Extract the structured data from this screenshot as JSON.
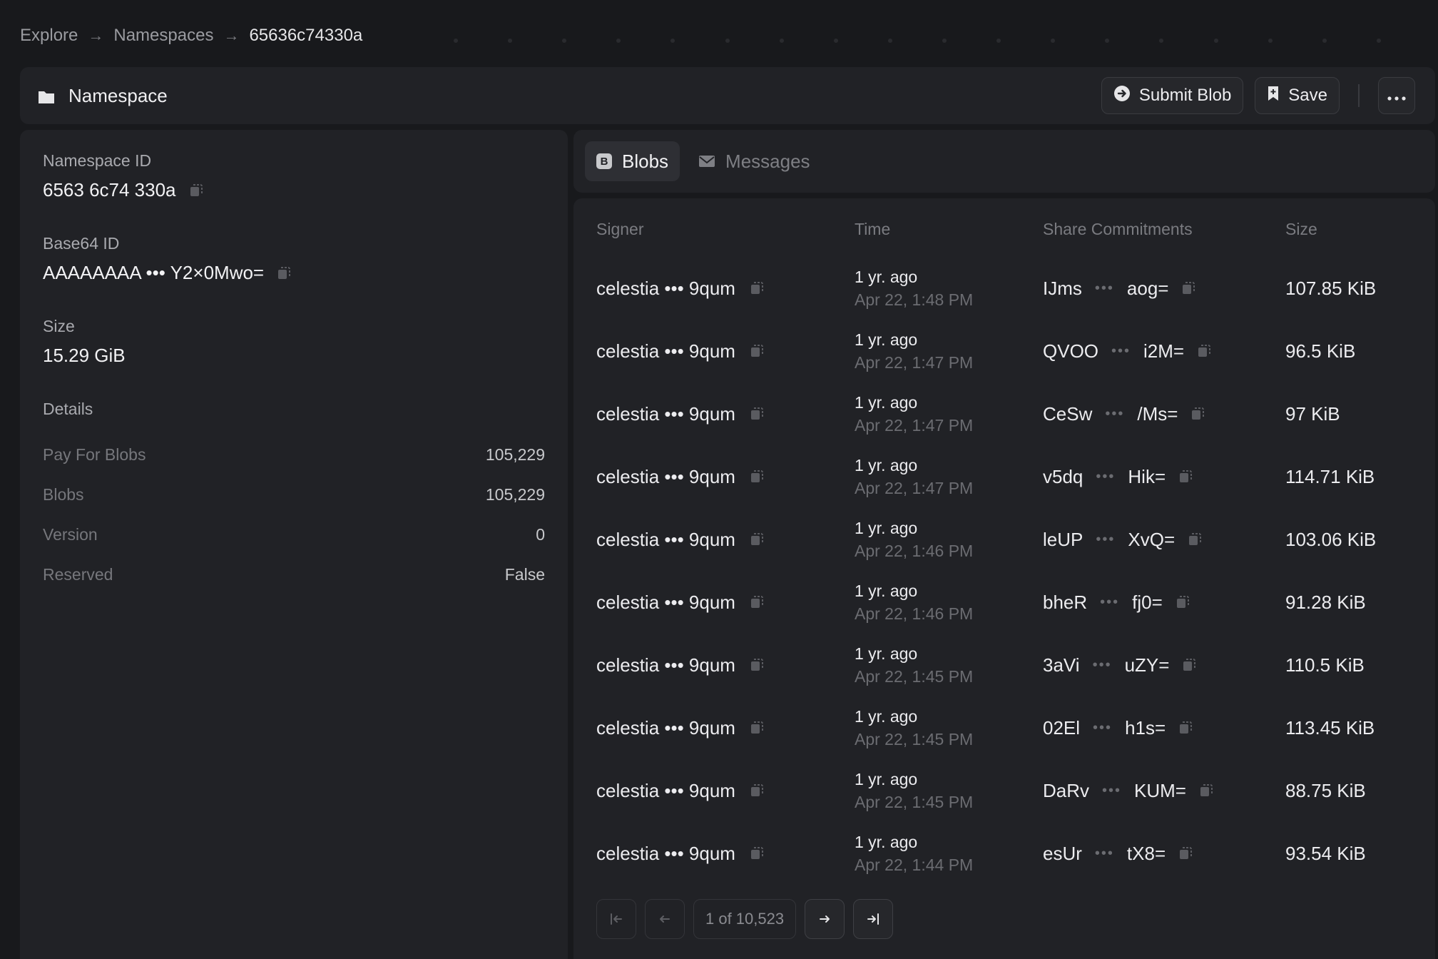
{
  "breadcrumb": {
    "items": [
      "Explore",
      "Namespaces",
      "65636c74330a"
    ]
  },
  "header": {
    "title": "Namespace",
    "submit_label": "Submit Blob",
    "save_label": "Save"
  },
  "namespace": {
    "id_label": "Namespace ID",
    "id_value": "6563 6c74 330a",
    "b64_label": "Base64 ID",
    "b64_value": "AAAAAAAA ••• Y2×0Mwo=",
    "size_label": "Size",
    "size_value": "15.29 GiB",
    "details_label": "Details",
    "details": [
      {
        "k": "Pay For Blobs",
        "v": "105,229"
      },
      {
        "k": "Blobs",
        "v": "105,229"
      },
      {
        "k": "Version",
        "v": "0"
      },
      {
        "k": "Reserved",
        "v": "False"
      }
    ]
  },
  "tabs": [
    {
      "label": "Blobs",
      "active": true,
      "icon": "b-icon"
    },
    {
      "label": "Messages",
      "active": false,
      "icon": "envelope-icon"
    }
  ],
  "table": {
    "headers": [
      "Signer",
      "Time",
      "Share Commitments",
      "Size"
    ],
    "rows": [
      {
        "signer": "celestia ••• 9qum",
        "rel": "1 yr. ago",
        "abs": "Apr 22, 1:48 PM",
        "c1": "IJms",
        "c2": "aog=",
        "size": "107.85 KiB"
      },
      {
        "signer": "celestia ••• 9qum",
        "rel": "1 yr. ago",
        "abs": "Apr 22, 1:47 PM",
        "c1": "QVOO",
        "c2": "i2M=",
        "size": "96.5 KiB"
      },
      {
        "signer": "celestia ••• 9qum",
        "rel": "1 yr. ago",
        "abs": "Apr 22, 1:47 PM",
        "c1": "CeSw",
        "c2": "/Ms=",
        "size": "97 KiB"
      },
      {
        "signer": "celestia ••• 9qum",
        "rel": "1 yr. ago",
        "abs": "Apr 22, 1:47 PM",
        "c1": "v5dq",
        "c2": "Hik=",
        "size": "114.71 KiB"
      },
      {
        "signer": "celestia ••• 9qum",
        "rel": "1 yr. ago",
        "abs": "Apr 22, 1:46 PM",
        "c1": "leUP",
        "c2": "XvQ=",
        "size": "103.06 KiB"
      },
      {
        "signer": "celestia ••• 9qum",
        "rel": "1 yr. ago",
        "abs": "Apr 22, 1:46 PM",
        "c1": "bheR",
        "c2": "fj0=",
        "size": "91.28 KiB"
      },
      {
        "signer": "celestia ••• 9qum",
        "rel": "1 yr. ago",
        "abs": "Apr 22, 1:45 PM",
        "c1": "3aVi",
        "c2": "uZY=",
        "size": "110.5 KiB"
      },
      {
        "signer": "celestia ••• 9qum",
        "rel": "1 yr. ago",
        "abs": "Apr 22, 1:45 PM",
        "c1": "02El",
        "c2": "h1s=",
        "size": "113.45 KiB"
      },
      {
        "signer": "celestia ••• 9qum",
        "rel": "1 yr. ago",
        "abs": "Apr 22, 1:45 PM",
        "c1": "DaRv",
        "c2": "KUM=",
        "size": "88.75 KiB"
      },
      {
        "signer": "celestia ••• 9qum",
        "rel": "1 yr. ago",
        "abs": "Apr 22, 1:44 PM",
        "c1": "esUr",
        "c2": "tX8=",
        "size": "93.54 KiB"
      }
    ]
  },
  "pagination": {
    "label": "1 of 10,523"
  },
  "colors": {
    "background": "#18191c",
    "panel": "#212226",
    "text": "#ececef",
    "muted": "#6b6c71"
  }
}
